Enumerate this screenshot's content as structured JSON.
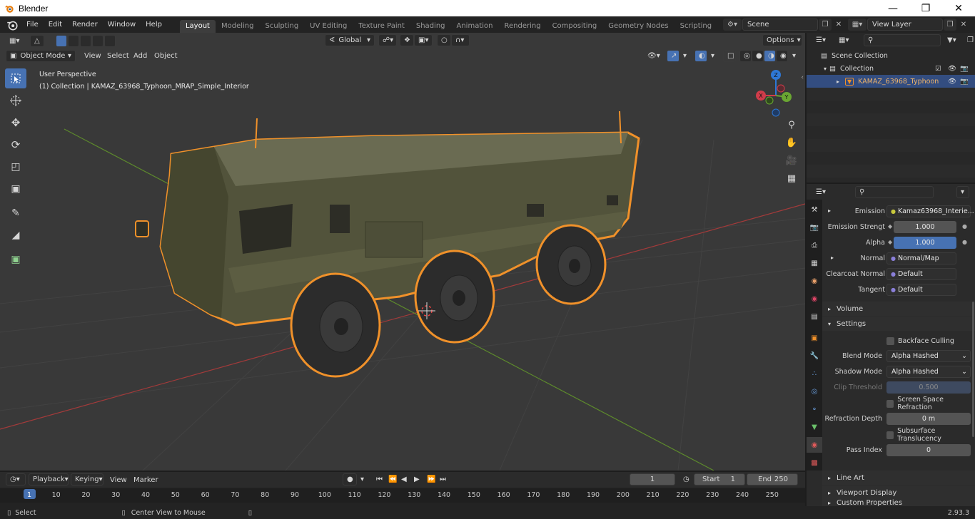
{
  "window": {
    "title": "Blender",
    "controls": [
      "minimize",
      "maximize",
      "close"
    ]
  },
  "topbar": {
    "menus": [
      "File",
      "Edit",
      "Render",
      "Window",
      "Help"
    ],
    "workspaces": [
      "Layout",
      "Modeling",
      "Sculpting",
      "UV Editing",
      "Texture Paint",
      "Shading",
      "Animation",
      "Rendering",
      "Compositing",
      "Geometry Nodes",
      "Scripting"
    ],
    "active_workspace": "Layout",
    "add_tab": "+",
    "scene": "Scene",
    "view_layer": "View Layer"
  },
  "viewport": {
    "mode": "Object Mode",
    "menus": [
      "View",
      "Select",
      "Add",
      "Object"
    ],
    "transform_orientation": "Global",
    "options_label": "Options",
    "perspective_label": "User Perspective",
    "collection_label": "(1) Collection | KAMAZ_63968_Typhoon_MRAP_Simple_Interior",
    "gizmo": {
      "z": "Z",
      "y": "Y",
      "x": "X"
    }
  },
  "outliner": {
    "rows": [
      {
        "label": "Scene Collection"
      },
      {
        "label": "Collection"
      },
      {
        "label": "KAMAZ_63968_Typhoon"
      }
    ]
  },
  "properties": {
    "rows": [
      {
        "label": "Emission",
        "value": "Kamaz63968_Interie..."
      },
      {
        "label": "Emission Strengt",
        "value": "1.000"
      },
      {
        "label": "Alpha",
        "value": "1.000"
      },
      {
        "label": "Normal",
        "value": "Normal/Map"
      },
      {
        "label": "Clearcoat Normal",
        "value": "Default"
      },
      {
        "label": "Tangent",
        "value": "Default"
      }
    ],
    "sections": {
      "volume": "Volume",
      "settings": "Settings",
      "line_art": "Line Art",
      "viewport_display": "Viewport Display",
      "custom_properties": "Custom Properties"
    },
    "settings": {
      "backface_culling": "Backface Culling",
      "blend_mode_label": "Blend Mode",
      "blend_mode": "Alpha Hashed",
      "shadow_mode_label": "Shadow Mode",
      "shadow_mode": "Alpha Hashed",
      "clip_threshold_label": "Clip Threshold",
      "clip_threshold": "0.500",
      "screen_space_refraction": "Screen Space Refraction",
      "refraction_depth_label": "Refraction Depth",
      "refraction_depth": "0 m",
      "subsurface_translucency": "Subsurface Translucency",
      "pass_index_label": "Pass Index",
      "pass_index": "0"
    }
  },
  "timeline": {
    "menus": [
      "Playback",
      "Keying",
      "View",
      "Marker"
    ],
    "current_frame": "1",
    "start_label": "Start",
    "start": "1",
    "end_label": "End",
    "end": "250",
    "ticks": [
      "1",
      "10",
      "20",
      "30",
      "40",
      "50",
      "60",
      "70",
      "80",
      "90",
      "100",
      "110",
      "120",
      "130",
      "140",
      "150",
      "160",
      "170",
      "180",
      "190",
      "200",
      "210",
      "220",
      "230",
      "240",
      "250"
    ]
  },
  "statusbar": {
    "left": "Select",
    "middle": "Center View to Mouse",
    "version": "2.93.3"
  },
  "colors": {
    "accent": "#4772b3",
    "selection_outline": "#f0912a",
    "viewport_bg": "#393939"
  }
}
